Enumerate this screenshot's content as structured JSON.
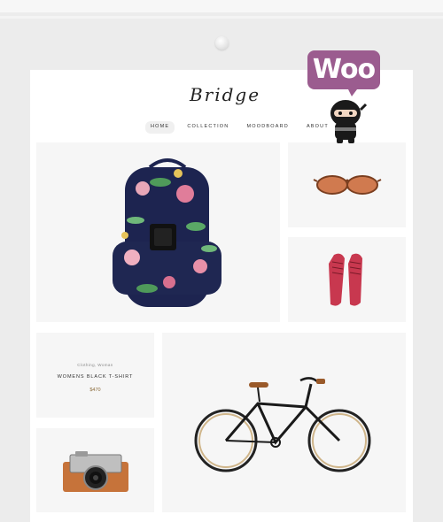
{
  "brand": {
    "name": "Bridge"
  },
  "nav": {
    "items": [
      "HOME",
      "COLLECTION",
      "MOODBOARD",
      "ABOUT"
    ],
    "active": "HOME"
  },
  "badge": {
    "text": "Woo",
    "mascot": "ninja"
  },
  "products": {
    "featured": {
      "category": "Clothing, Woman",
      "name": "WOMENS BLACK T-SHIRT",
      "price": "$470"
    }
  },
  "images": [
    "floral-backpack",
    "sunglasses",
    "red-shoes",
    "bicycle",
    "camera"
  ],
  "colors": {
    "background": "#ececec",
    "page": "#ffffff",
    "tile": "#f6f6f6",
    "woo_purple": "#9b5c8f",
    "price": "#8a6a3a"
  }
}
